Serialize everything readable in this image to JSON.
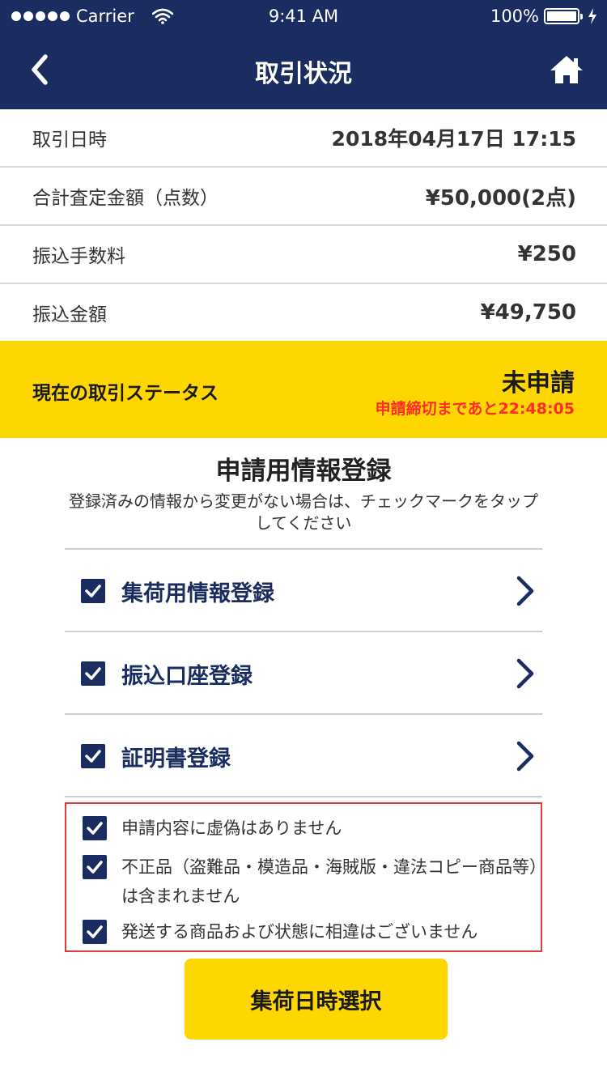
{
  "status_bar": {
    "carrier": "Carrier",
    "time": "9:41 AM",
    "battery": "100%"
  },
  "nav": {
    "title": "取引状況",
    "back_icon": "chevron-left-icon",
    "home_icon": "home-icon"
  },
  "info": [
    {
      "label": "取引日時",
      "value": "2018年04月17日 17:15"
    },
    {
      "label": "合計査定金額（点数）",
      "value": "¥50,000(2点)"
    },
    {
      "label": "振込手数料",
      "value": "¥250"
    },
    {
      "label": "振込金額",
      "value": "¥49,750"
    }
  ],
  "status": {
    "label": "現在の取引ステータス",
    "value": "未申請",
    "deadline": "申請締切まであと22:48:05"
  },
  "registration": {
    "title": "申請用情報登録",
    "description": "登録済みの情報から変更がない場合は、チェックマークをタップしてください",
    "items": [
      {
        "label": "集荷用情報登録",
        "checked": true
      },
      {
        "label": "振込口座登録",
        "checked": true
      },
      {
        "label": "証明書登録",
        "checked": true
      }
    ]
  },
  "agreements": [
    {
      "text": "申請内容に虚偽はありません",
      "checked": true
    },
    {
      "text": "不正品（盗難品・模造品・海賊版・違法コピー商品等）は含まれません",
      "checked": true
    },
    {
      "text": "発送する商品および状態に相違はございません",
      "checked": true
    }
  ],
  "cta": {
    "label": "集荷日時選択"
  },
  "colors": {
    "navy": "#1b2d60",
    "yellow": "#ffd700",
    "alert_red": "#ff2a2a",
    "border_red": "#e5383b"
  }
}
